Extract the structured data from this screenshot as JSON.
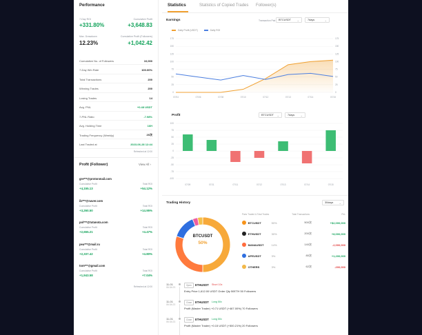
{
  "performance": {
    "title": "Performance",
    "roi_7d_label": "7-Day ROI",
    "roi_7d_value": "+331.80%",
    "cum_profit_label": "Cumulative Profit",
    "cum_profit_value": "+3,648.83",
    "max_drawdown_label": "Max. Drawdown",
    "max_drawdown_value": "12.23%",
    "cum_profit_followers_label": "Cumulative Profit (Followers)",
    "cum_profit_followers_value": "+1,042.42",
    "stats": [
      {
        "label": "Cumulative No. of Followers",
        "value": "10,000",
        "color": "dark"
      },
      {
        "label": "7-Day Win Rate",
        "value": "100.00%",
        "color": "dark"
      },
      {
        "label": "Total Transactions",
        "value": "200",
        "color": "dark"
      },
      {
        "label": "Winning Trades",
        "value": "200",
        "color": "dark"
      },
      {
        "label": "Losing Trades",
        "value": "14",
        "color": "dark"
      },
      {
        "label": "Avg. PNL",
        "value": "+0.48 USDT",
        "color": "green"
      },
      {
        "label": "7-PNL Ratio",
        "value": "-7.98%",
        "color": "green"
      },
      {
        "label": "Avg. Holding Time",
        "value": "16H",
        "color": "green"
      },
      {
        "label": "Trading Frequency (Weekly)",
        "value": "20次",
        "color": "dark"
      },
      {
        "label": "Last Traded at",
        "value": "2023-06-28 12:44",
        "color": "green"
      }
    ],
    "updated_note": "Refreshed at 12:00"
  },
  "profit_followers": {
    "title": "Profit (Follower)",
    "view_all": "View All",
    "items": [
      {
        "email": "gre***@protonmail.com",
        "l1": "Cumulative Profit",
        "l2": "Total ROI",
        "v1": "+4,155.13",
        "v2": "+54.12%"
      },
      {
        "email": "ilz***@naver.com",
        "l1": "Cumulative Profit",
        "l2": "Total ROI",
        "v1": "+3,260.50",
        "v2": "+14.95%"
      },
      {
        "email": "pol***@tutanota.com",
        "l1": "Cumulative Profit",
        "l2": "Total ROI",
        "v1": "+2,655.21",
        "v2": "+4.47%"
      },
      {
        "email": "pea***@mail.ru",
        "l1": "Cumulative Profit",
        "l2": "Total ROI",
        "v1": "+2,337.42",
        "v2": "+4.80%"
      },
      {
        "email": "tom***@gmail.com",
        "l1": "Cumulative Profit",
        "l2": "Total ROI",
        "v1": "+1,943.58",
        "v2": "+7.04%"
      }
    ],
    "footer": "Refreshed at 12:00"
  },
  "tabs": [
    {
      "label": "Statistics",
      "active": true
    },
    {
      "label": "Statistics of Copied Trades",
      "active": false
    },
    {
      "label": "Follower(s)",
      "active": false
    }
  ],
  "earnings": {
    "title": "Earnings",
    "legend_a": "Daily Profit (USDT)",
    "legend_b": "Daily ROI",
    "pair_label": "Transaction Pair",
    "pair_value": "BTCUSDT",
    "period_value": "7days"
  },
  "pnl": {
    "title": "Profit",
    "pair_value": "BTCUSDT",
    "period_value": "7days"
  },
  "trading_history": {
    "title": "Trading History",
    "period_value": "30days",
    "col_pair": "Pairs Traded & Total Trades",
    "col_tx": "Total Transactions",
    "col_pnl": "PnL",
    "donut_center": "BTCUSDT",
    "donut_pct": "50%",
    "pairs": [
      {
        "name": "BTCUSDT",
        "pct": "50%",
        "tx": "500次",
        "pnl": "+$2,000,000",
        "pnl_color": "#13a35b",
        "coin": "#f7931a"
      },
      {
        "name": "ETHUSDT",
        "pct": "30%",
        "tx": "200次",
        "pnl": "+8,000,000",
        "pnl_color": "#13a35b",
        "coin": "#222222"
      },
      {
        "name": "MANAUSDT",
        "pct": "14%",
        "tx": "140次",
        "pnl": "-2,000,000",
        "pnl_color": "#e03a3a",
        "coin": "#ff6b3d"
      },
      {
        "name": "APEUSDT",
        "pct": "3%",
        "tx": "80次",
        "pnl": "+1,200,000",
        "pnl_color": "#13a35b",
        "coin": "#2f6fe0"
      },
      {
        "name": "OTHERS",
        "pct": "3%",
        "tx": "62次",
        "pnl": "-200,000",
        "pnl_color": "#e03a3a",
        "coin": "#f2b84a"
      }
    ]
  },
  "trades": [
    {
      "date": "11-01",
      "time": "06:34:23",
      "tag": "Open",
      "symbol": "ETHUSDT",
      "side": "Short 10x",
      "side_color": "#e03a3a",
      "detail": "Entry Price  1,612.00 USDT   Order Qty  50ETH   50 Followers"
    },
    {
      "date": "11-01",
      "time": "06:34:23",
      "tag": "Close",
      "symbol": "ETHUSDT",
      "side": "Long 50x",
      "side_color": "#13a35b",
      "detail": "Profit (Master Trader)  +0.71 USDT (+467.00%)   70 Followers"
    },
    {
      "date": "11-01",
      "time": "06:34:23",
      "tag": "Close",
      "symbol": "ETHUSDT",
      "side": "Long 50x",
      "side_color": "#13a35b",
      "detail": "Profit (Master Trader)  +0.15 USDT (+500.21%)   20 Followers"
    }
  ],
  "chart_data": [
    {
      "type": "line",
      "x": [
        "07/04",
        "07/06",
        "07/08",
        "07/10",
        "07/12",
        "07/13",
        "07/14",
        "07/15"
      ],
      "series": [
        {
          "name": "Daily Profit (USDT)",
          "values": [
            0,
            0,
            0,
            10,
            45,
            90,
            100,
            105
          ]
        },
        {
          "name": "Daily ROI",
          "values": [
            60,
            50,
            40,
            55,
            42,
            58,
            62,
            52
          ]
        }
      ],
      "y_left_ticks": [
        "175",
        "150",
        "125",
        "100",
        "75",
        "50",
        "25",
        "0"
      ],
      "y_right_ticks": [
        "175",
        "150",
        "125",
        "100",
        "75",
        "50",
        "25",
        "0"
      ],
      "ylim": [
        0,
        175
      ],
      "colors": {
        "profit": "#f0a030",
        "roi": "#4a7ee0"
      },
      "legend_position": "top-left"
    },
    {
      "type": "bar",
      "categories": [
        "07/09",
        "07/11",
        "07/11",
        "07/12",
        "07/13",
        "07/14",
        "07/15"
      ],
      "values": [
        60,
        40,
        -40,
        -25,
        35,
        -45,
        75
      ],
      "y_ticks": [
        "100",
        "75",
        "50",
        "25",
        "0",
        "-25",
        "-50",
        "-75",
        "-100"
      ],
      "ylim": [
        -100,
        100
      ],
      "colors": {
        "positive": "#3dbd74",
        "negative": "#f07272"
      }
    },
    {
      "type": "pie",
      "categories": [
        "BTCUSDT",
        "ETHUSDT",
        "MANAUSDT",
        "APEUSDT",
        "OTHERS"
      ],
      "values": [
        50,
        30,
        14,
        3,
        3
      ],
      "colors": [
        "#f7a93a",
        "#ff7a3d",
        "#2f6fe0",
        "#ee5fa0",
        "#f5c04a"
      ]
    }
  ]
}
